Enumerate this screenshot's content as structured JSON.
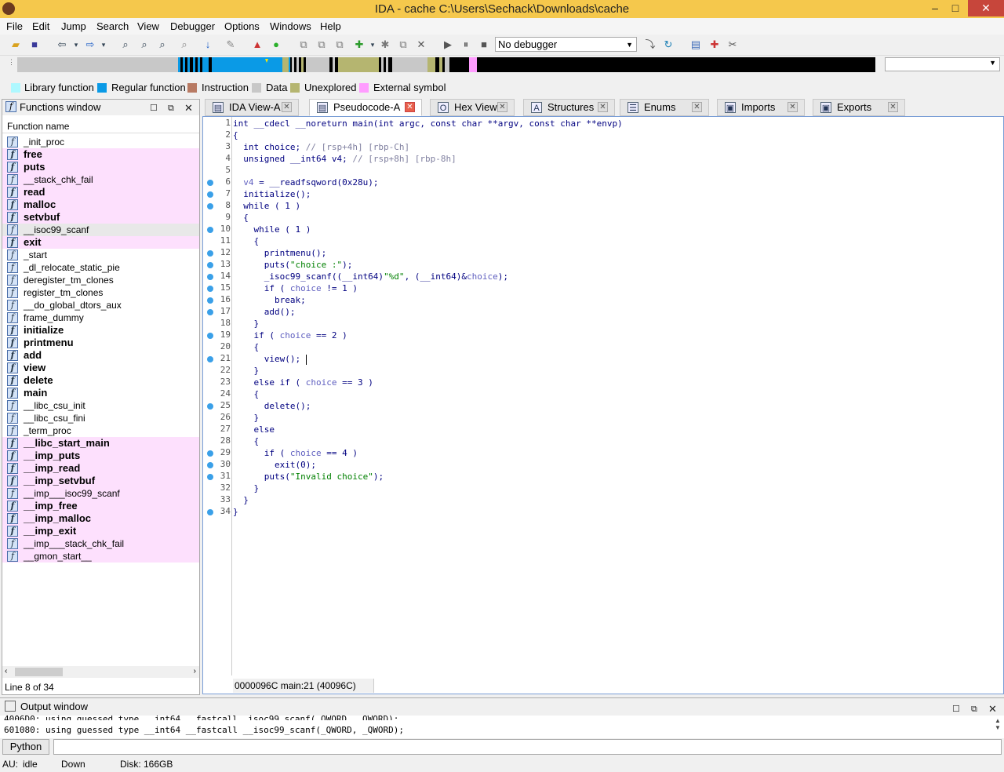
{
  "window": {
    "title": "IDA - cache C:\\Users\\Sechack\\Downloads\\cache",
    "minimize": "–",
    "maximize": "□",
    "close": "✕"
  },
  "menu": [
    "File",
    "Edit",
    "Jump",
    "Search",
    "View",
    "Debugger",
    "Options",
    "Windows",
    "Help"
  ],
  "toolbar": {
    "debugger_select": "No debugger"
  },
  "legend": [
    {
      "label": "Library function",
      "color": "#aef8ff"
    },
    {
      "label": "Regular function",
      "color": "#0a9ae6"
    },
    {
      "label": "Instruction",
      "color": "#b87a63"
    },
    {
      "label": "Data",
      "color": "#c8c8c8"
    },
    {
      "label": "Unexplored",
      "color": "#b5b570"
    },
    {
      "label": "External symbol",
      "color": "#ff9cff"
    }
  ],
  "functions_window": {
    "title": "Functions window",
    "column": "Function name",
    "items": [
      {
        "name": "_init_proc",
        "lib": false,
        "bold": false
      },
      {
        "name": "free",
        "lib": true,
        "bold": true
      },
      {
        "name": "puts",
        "lib": true,
        "bold": true
      },
      {
        "name": "__stack_chk_fail",
        "lib": true,
        "bold": false
      },
      {
        "name": "read",
        "lib": true,
        "bold": true
      },
      {
        "name": "malloc",
        "lib": true,
        "bold": true
      },
      {
        "name": "setvbuf",
        "lib": true,
        "bold": true
      },
      {
        "name": "__isoc99_scanf",
        "lib": false,
        "bold": false,
        "selected": true
      },
      {
        "name": "exit",
        "lib": true,
        "bold": true
      },
      {
        "name": "_start",
        "lib": false,
        "bold": false
      },
      {
        "name": "_dl_relocate_static_pie",
        "lib": false,
        "bold": false
      },
      {
        "name": "deregister_tm_clones",
        "lib": false,
        "bold": false
      },
      {
        "name": "register_tm_clones",
        "lib": false,
        "bold": false
      },
      {
        "name": "__do_global_dtors_aux",
        "lib": false,
        "bold": false
      },
      {
        "name": "frame_dummy",
        "lib": false,
        "bold": false
      },
      {
        "name": "initialize",
        "lib": false,
        "bold": true
      },
      {
        "name": "printmenu",
        "lib": false,
        "bold": true
      },
      {
        "name": "add",
        "lib": false,
        "bold": true
      },
      {
        "name": "view",
        "lib": false,
        "bold": true
      },
      {
        "name": "delete",
        "lib": false,
        "bold": true
      },
      {
        "name": "main",
        "lib": false,
        "bold": true
      },
      {
        "name": "__libc_csu_init",
        "lib": false,
        "bold": false
      },
      {
        "name": "__libc_csu_fini",
        "lib": false,
        "bold": false
      },
      {
        "name": "_term_proc",
        "lib": false,
        "bold": false
      },
      {
        "name": "__libc_start_main",
        "lib": true,
        "bold": true
      },
      {
        "name": "__imp_puts",
        "lib": true,
        "bold": true
      },
      {
        "name": "__imp_read",
        "lib": true,
        "bold": true
      },
      {
        "name": "__imp_setvbuf",
        "lib": true,
        "bold": true
      },
      {
        "name": "__imp___isoc99_scanf",
        "lib": true,
        "bold": false
      },
      {
        "name": "__imp_free",
        "lib": true,
        "bold": true
      },
      {
        "name": "__imp_malloc",
        "lib": true,
        "bold": true
      },
      {
        "name": "__imp_exit",
        "lib": true,
        "bold": true
      },
      {
        "name": "__imp___stack_chk_fail",
        "lib": true,
        "bold": false
      },
      {
        "name": "__gmon_start__",
        "lib": true,
        "bold": false
      }
    ],
    "status": "Line 8 of 34"
  },
  "tabs": [
    {
      "label": "IDA View-A",
      "icon": "▤",
      "active": false
    },
    {
      "label": "Pseudocode-A",
      "icon": "▤",
      "active": true
    },
    {
      "label": "Hex View-1",
      "icon": "O",
      "active": false
    },
    {
      "label": "Structures",
      "icon": "A",
      "active": false
    },
    {
      "label": "Enums",
      "icon": "☰",
      "active": false
    },
    {
      "label": "Imports",
      "icon": "▣",
      "active": false
    },
    {
      "label": "Exports",
      "icon": "▣",
      "active": false
    }
  ],
  "pseudocode": {
    "lines": [
      {
        "n": "1",
        "dot": false,
        "html": "int __cdecl __noreturn main(int argc, const char **argv, const char **envp)"
      },
      {
        "n": "2",
        "dot": false,
        "html": "{"
      },
      {
        "n": "3",
        "dot": false,
        "html": "  int choice; <span class='cm'>// [rsp+4h] [rbp-Ch]</span>"
      },
      {
        "n": "4",
        "dot": false,
        "html": "  unsigned __int64 v4; <span class='cm'>// [rsp+8h] [rbp-8h]</span>"
      },
      {
        "n": "5",
        "dot": false,
        "html": ""
      },
      {
        "n": "6",
        "dot": true,
        "html": "  <span class='vr'>v4</span> = __readfsqword(0x28u);"
      },
      {
        "n": "7",
        "dot": true,
        "html": "  initialize();"
      },
      {
        "n": "8",
        "dot": true,
        "html": "  while ( 1 )"
      },
      {
        "n": "9",
        "dot": false,
        "html": "  {"
      },
      {
        "n": "10",
        "dot": true,
        "html": "    while ( 1 )"
      },
      {
        "n": "11",
        "dot": false,
        "html": "    {"
      },
      {
        "n": "12",
        "dot": true,
        "html": "      printmenu();"
      },
      {
        "n": "13",
        "dot": true,
        "html": "      puts(<span class='st'>\"choice :\"</span>);"
      },
      {
        "n": "14",
        "dot": true,
        "html": "      _isoc99_scanf((__int64)<span class='st'>\"%d\"</span>, (__int64)&amp;<span class='vr'>choice</span>);"
      },
      {
        "n": "15",
        "dot": true,
        "html": "      if ( <span class='vr'>choice</span> != 1 )"
      },
      {
        "n": "16",
        "dot": true,
        "html": "        break;"
      },
      {
        "n": "17",
        "dot": true,
        "html": "      add();"
      },
      {
        "n": "18",
        "dot": false,
        "html": "    }"
      },
      {
        "n": "19",
        "dot": true,
        "html": "    if ( <span class='vr'>choice</span> == 2 )"
      },
      {
        "n": "20",
        "dot": false,
        "html": "    {"
      },
      {
        "n": "21",
        "dot": true,
        "html": "      view(); <span class='caret'></span>"
      },
      {
        "n": "22",
        "dot": false,
        "html": "    }"
      },
      {
        "n": "23",
        "dot": false,
        "html": "    else if ( <span class='vr'>choice</span> == 3 )"
      },
      {
        "n": "24",
        "dot": false,
        "html": "    {"
      },
      {
        "n": "25",
        "dot": true,
        "html": "      delete();"
      },
      {
        "n": "26",
        "dot": false,
        "html": "    }"
      },
      {
        "n": "27",
        "dot": false,
        "html": "    else"
      },
      {
        "n": "28",
        "dot": false,
        "html": "    {"
      },
      {
        "n": "29",
        "dot": true,
        "html": "      if ( <span class='vr'>choice</span> == 4 )"
      },
      {
        "n": "30",
        "dot": true,
        "html": "        exit(0);"
      },
      {
        "n": "31",
        "dot": true,
        "html": "      puts(<span class='st'>\"Invalid choice\"</span>);"
      },
      {
        "n": "32",
        "dot": false,
        "html": "    }"
      },
      {
        "n": "33",
        "dot": false,
        "html": "  }"
      },
      {
        "n": "34",
        "dot": true,
        "html": "}"
      }
    ],
    "status": "0000096C main:21 (40096C)"
  },
  "output": {
    "title": "Output window",
    "lines": [
      "4006D0: using guessed type __int64 __fastcall _isoc99_scanf(_QWORD, _QWORD);",
      "601080: using guessed type __int64 __fastcall __isoc99_scanf(_QWORD, _QWORD);"
    ]
  },
  "python_button": "Python",
  "statusbar": {
    "au_label": "AU:",
    "au_state": "idle",
    "direction": "Down",
    "disk": "Disk: 166GB"
  }
}
